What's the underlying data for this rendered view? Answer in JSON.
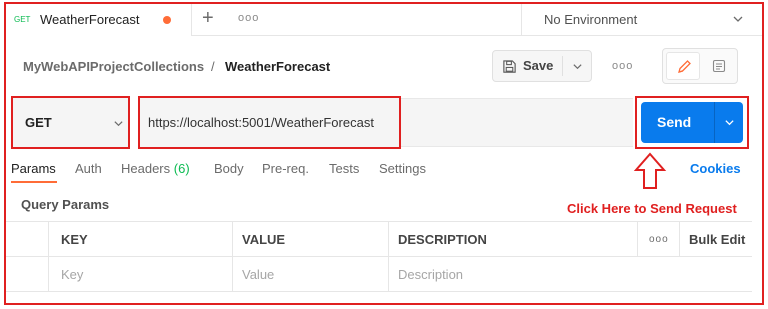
{
  "tab": {
    "method": "GET",
    "title": "WeatherForecast",
    "add_icon": "plus-icon",
    "more_label": "ooo"
  },
  "environment": {
    "selected": "No Environment"
  },
  "breadcrumb": {
    "collection": "MyWebAPIProjectCollections",
    "separator": "/",
    "request": "WeatherForecast"
  },
  "toolbar": {
    "save_label": "Save",
    "more_label": "ooo"
  },
  "request": {
    "method": "GET",
    "url": "https://localhost:5001/WeatherForecast",
    "send_label": "Send"
  },
  "subtabs": {
    "params": "Params",
    "auth": "Auth",
    "headers": "Headers",
    "headers_count": "(6)",
    "body": "Body",
    "prereq": "Pre-req.",
    "tests": "Tests",
    "settings": "Settings",
    "cookies": "Cookies"
  },
  "annotation": {
    "text": "Click Here to Send Request"
  },
  "query_params": {
    "title": "Query Params",
    "columns": [
      "KEY",
      "VALUE",
      "DESCRIPTION"
    ],
    "more_label": "ooo",
    "bulk_edit": "Bulk Edit",
    "placeholders": [
      "Key",
      "Value",
      "Description"
    ]
  },
  "colors": {
    "accent": "#ff6c37",
    "send_blue": "#097bed",
    "get_green": "#0cbb52",
    "highlight_red": "#e02020"
  }
}
